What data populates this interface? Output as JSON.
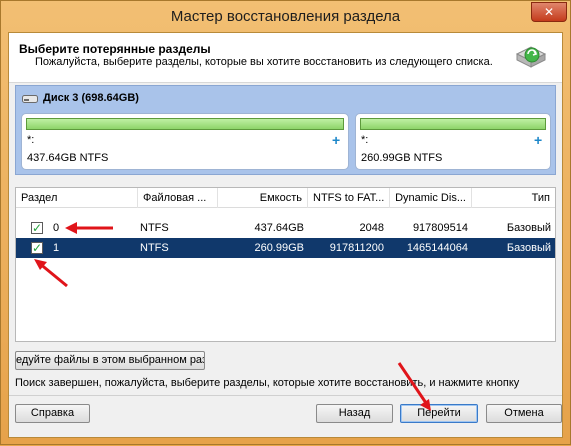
{
  "window": {
    "title": "Мастер восстановления раздела",
    "close_glyph": "✕"
  },
  "header": {
    "title": "Выберите потерянные разделы",
    "description": "Пожалуйста, выберите разделы, которые вы хотите восстановить из следующего списка.",
    "icon": "recovery-disk-icon"
  },
  "disk": {
    "label": "Диск 3 (698.64GB)",
    "icon": "disk-icon",
    "partitions": [
      {
        "name": "*:",
        "size": "437.64GB NTFS"
      },
      {
        "name": "*:",
        "size": "260.99GB NTFS"
      }
    ]
  },
  "table": {
    "columns": [
      "Раздел",
      "Файловая ...",
      "Емкость",
      "NTFS to FAT...",
      "Dynamic Dis...",
      "Тип"
    ],
    "rows": [
      {
        "checked": true,
        "partition": "0",
        "fs": "NTFS",
        "capacity": "437.64GB",
        "ntfs_fat": "2048",
        "dynamic": "917809514",
        "type": "Базовый",
        "selected": false
      },
      {
        "checked": true,
        "partition": "1",
        "fs": "NTFS",
        "capacity": "260.99GB",
        "ntfs_fat": "917811200",
        "dynamic": "1465144064",
        "type": "Базовый",
        "selected": true
      }
    ]
  },
  "browse_button": "едуйте файлы в этом выбранном раз",
  "status": "Поиск завершен, пожалуйста, выберите разделы, которые хотите восстановить, и нажмите кнопку",
  "footer": {
    "help": "Справка",
    "back": "Назад",
    "next": "Перейти",
    "cancel": "Отмена"
  },
  "colors": {
    "accent": "#10386b",
    "title_bar": "#e6a24a",
    "disk_panel": "#a9c3ea",
    "partition_bar": "#8ed46a",
    "annotation_arrow": "#e0141a"
  }
}
